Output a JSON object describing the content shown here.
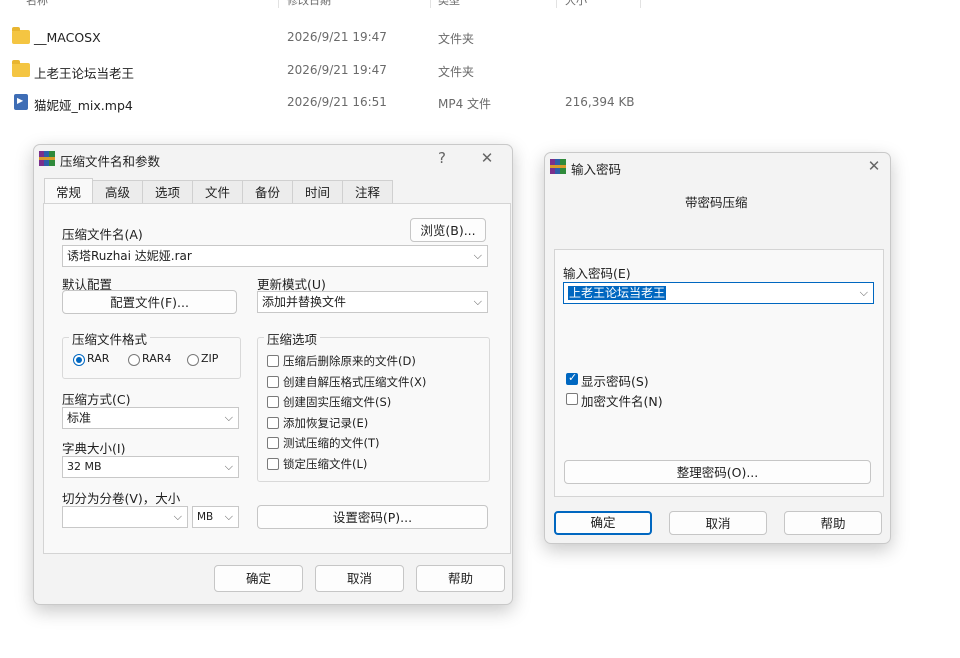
{
  "explorer": {
    "columns": {
      "name": "名称",
      "date": "修改日期",
      "type": "类型",
      "size": "大小"
    },
    "rows": [
      {
        "name": "__MACOSX",
        "date": "2026/9/21 19:47",
        "type": "文件夹",
        "size": "",
        "icon": "folder-icon"
      },
      {
        "name": "上老王论坛当老王",
        "date": "2026/9/21 19:47",
        "type": "文件夹",
        "size": "",
        "icon": "folder-icon"
      },
      {
        "name": "猫妮娅_mix.mp4",
        "date": "2026/9/21 16:51",
        "type": "MP4 文件",
        "size": "216,394 KB",
        "icon": "video-file-icon"
      }
    ]
  },
  "archive_dialog": {
    "title": "压缩文件名和参数",
    "help_glyph": "?",
    "close_glyph": "✕",
    "tabs": [
      "常规",
      "高级",
      "选项",
      "文件",
      "备份",
      "时间",
      "注释"
    ],
    "archive_name_label": "压缩文件名(A)",
    "browse_button": "浏览(B)...",
    "archive_name_value": "诱塔Ruzhai 达妮娅.rar",
    "default_profile_label": "默认配置",
    "profiles_button": "配置文件(F)...",
    "update_mode_label": "更新模式(U)",
    "update_mode_value": "添加并替换文件",
    "format_group_title": "压缩文件格式",
    "formats": [
      "RAR",
      "RAR4",
      "ZIP"
    ],
    "selected_format": "RAR",
    "options_group_title": "压缩选项",
    "options": [
      {
        "label": "压缩后删除原来的文件(D)",
        "checked": false
      },
      {
        "label": "创建自解压格式压缩文件(X)",
        "checked": false
      },
      {
        "label": "创建固实压缩文件(S)",
        "checked": false
      },
      {
        "label": "添加恢复记录(E)",
        "checked": false
      },
      {
        "label": "测试压缩的文件(T)",
        "checked": false
      },
      {
        "label": "锁定压缩文件(L)",
        "checked": false
      }
    ],
    "method_label": "压缩方式(C)",
    "method_value": "标准",
    "dict_label": "字典大小(I)",
    "dict_value": "32 MB",
    "split_label": "切分为分卷(V)，大小",
    "split_value": "",
    "split_unit": "MB",
    "set_password_button": "设置密码(P)...",
    "ok_button": "确定",
    "cancel_button": "取消",
    "help_button": "帮助"
  },
  "password_dialog": {
    "title": "输入密码",
    "close_glyph": "✕",
    "heading": "带密码压缩",
    "password_label": "输入密码(E)",
    "password_value": "上老王论坛当老王",
    "show_password_label": "显示密码(S)",
    "show_password_checked": true,
    "encrypt_names_label": "加密文件名(N)",
    "encrypt_names_checked": false,
    "organize_button": "整理密码(O)...",
    "ok_button": "确定",
    "cancel_button": "取消",
    "help_button": "帮助"
  },
  "colors": {
    "accent": "#0067c0",
    "folder": "#f4c542",
    "dialog_bg": "#f3f3f3"
  }
}
